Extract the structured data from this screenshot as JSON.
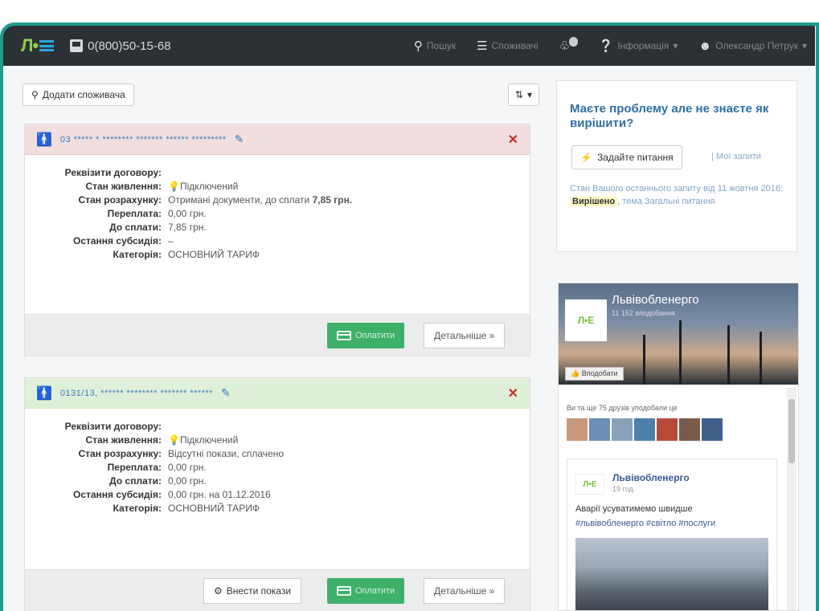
{
  "header": {
    "phone": "0(800)50-15-68",
    "nav": [
      {
        "icon": "search-icon",
        "label": "Пошук"
      },
      {
        "icon": "list-icon",
        "label": "Споживачі"
      },
      {
        "icon": "bell-icon",
        "label": ""
      },
      {
        "icon": "info-icon",
        "label": "Інформація"
      },
      {
        "icon": "user-icon",
        "label": "Олександр Петрук"
      }
    ]
  },
  "toolbar": {
    "add_consumer": "Додати споживача"
  },
  "accounts": [
    {
      "status": "alert",
      "title": "03 ***** * ******** ******* ****** *********",
      "fields": [
        {
          "k": "Реквізити договору:",
          "v": ""
        },
        {
          "k": "Стан живлення:",
          "v": "Підключений"
        },
        {
          "k": "Стан розрахунку:",
          "v": "Отримані документи, до сплати",
          "v_bold": "7,85 грн."
        },
        {
          "k": "Переплата:",
          "v": "0,00 грн."
        },
        {
          "k": "До сплати:",
          "v": "7,85 грн."
        },
        {
          "k": "Остання субсидія:",
          "v": "–"
        },
        {
          "k": "Категорія:",
          "v": "ОСНОВНИЙ ТАРИФ"
        }
      ],
      "pay": "Оплатити",
      "more": "Детальніше »"
    },
    {
      "status": "ok",
      "title": "0131/13, ****** ******** ******* ******",
      "fields": [
        {
          "k": "Реквізити договору:",
          "v": ""
        },
        {
          "k": "Стан живлення:",
          "v": "Підключений"
        },
        {
          "k": "Стан розрахунку:",
          "v": "Відсутні покази, сплачено"
        },
        {
          "k": "Переплата:",
          "v": "0,00 грн."
        },
        {
          "k": "До сплати:",
          "v": "0,00 грн."
        },
        {
          "k": "Остання субсидія:",
          "v": "0,00 грн. на 01.12.2016"
        },
        {
          "k": "Категорія:",
          "v": "ОСНОВНИЙ ТАРИФ"
        }
      ],
      "meter": "Внести покази",
      "pay": "Оплатити",
      "more": "Детальніше »"
    }
  ],
  "help": {
    "title": "Маєте проблему але не знаєте як вирішити?",
    "ask": "Задайте питання",
    "my_requests": "| Мої запити",
    "status_prefix": "Стан Вашого останнього запиту від 11 жовтня 2016:",
    "status_value": "Вирішено",
    "status_suffix": ", тема Загальні питання"
  },
  "facebook": {
    "page_name": "Львівобленерго",
    "subtitle": "11 152 вподобання",
    "like": "Вподобати",
    "friends": "Ви та ще 75 друзів уподобали це",
    "post_name": "Львівобленерго",
    "post_date": "19 год.",
    "post_text": "Аварії усуватимемо швидше",
    "post_tags": "#львівобленерго #світло #послуги"
  },
  "colors": {
    "topbar": "#2b3135",
    "frame": "#1f9a8f",
    "pay": "#3fb06a",
    "alert_head": "#f2dede",
    "ok_head": "#dff0d8",
    "link": "#2f6fa7"
  }
}
